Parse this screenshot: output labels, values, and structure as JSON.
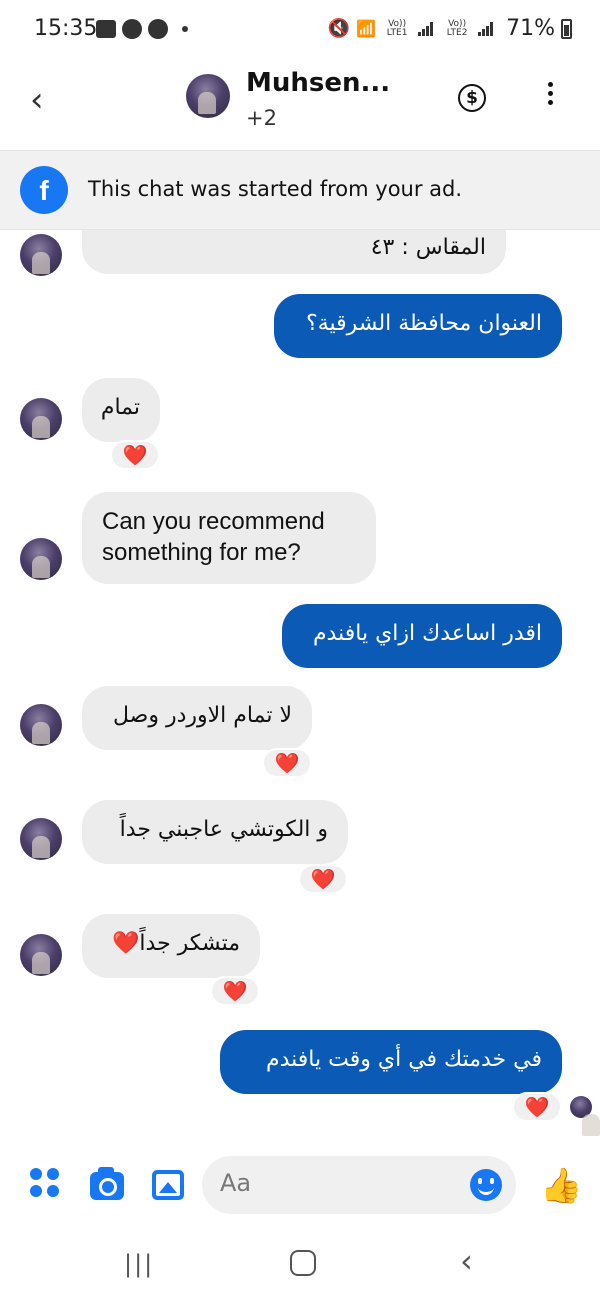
{
  "status_bar": {
    "time": "15:35",
    "lte1": "Vo)) LTE1",
    "lte2": "Vo)) LTE2",
    "battery": "71%"
  },
  "header": {
    "name": "Muhsen...",
    "participants": "+2",
    "dollar_symbol": "$"
  },
  "ad_banner": {
    "text": "This chat was started from your ad."
  },
  "messages": [
    {
      "direction": "in",
      "text": "المقاس : ٤٣",
      "reaction": null
    },
    {
      "direction": "out",
      "text": "العنوان محافظة الشرقية؟",
      "reaction": null
    },
    {
      "direction": "in",
      "text": "تمام",
      "reaction": "❤️"
    },
    {
      "direction": "in",
      "text_lines": [
        "Can you recommend",
        "something for me?"
      ],
      "reaction": null
    },
    {
      "direction": "out",
      "text": "اقدر اساعدك ازاي يافندم",
      "reaction": null
    },
    {
      "direction": "in",
      "text": "لا تمام الاوردر وصل",
      "reaction": "❤️"
    },
    {
      "direction": "in",
      "text": "و الكوتشي عاجبني جداً",
      "reaction": "❤️"
    },
    {
      "direction": "in",
      "text": "متشكر جداً❤️",
      "reaction": "❤️"
    },
    {
      "direction": "out",
      "text": "في خدمتك في أي وقت يافندم",
      "reaction": "❤️"
    }
  ],
  "composer": {
    "placeholder": "Aa",
    "icons": [
      "apps-icon",
      "camera-icon",
      "gallery-icon",
      "emoji-icon",
      "thumbs-up-icon"
    ]
  },
  "colors": {
    "outgoing_bubble": "#0b5ab5",
    "incoming_bubble": "#ececec",
    "accent": "#1877f2",
    "heart": "#e0101e"
  }
}
